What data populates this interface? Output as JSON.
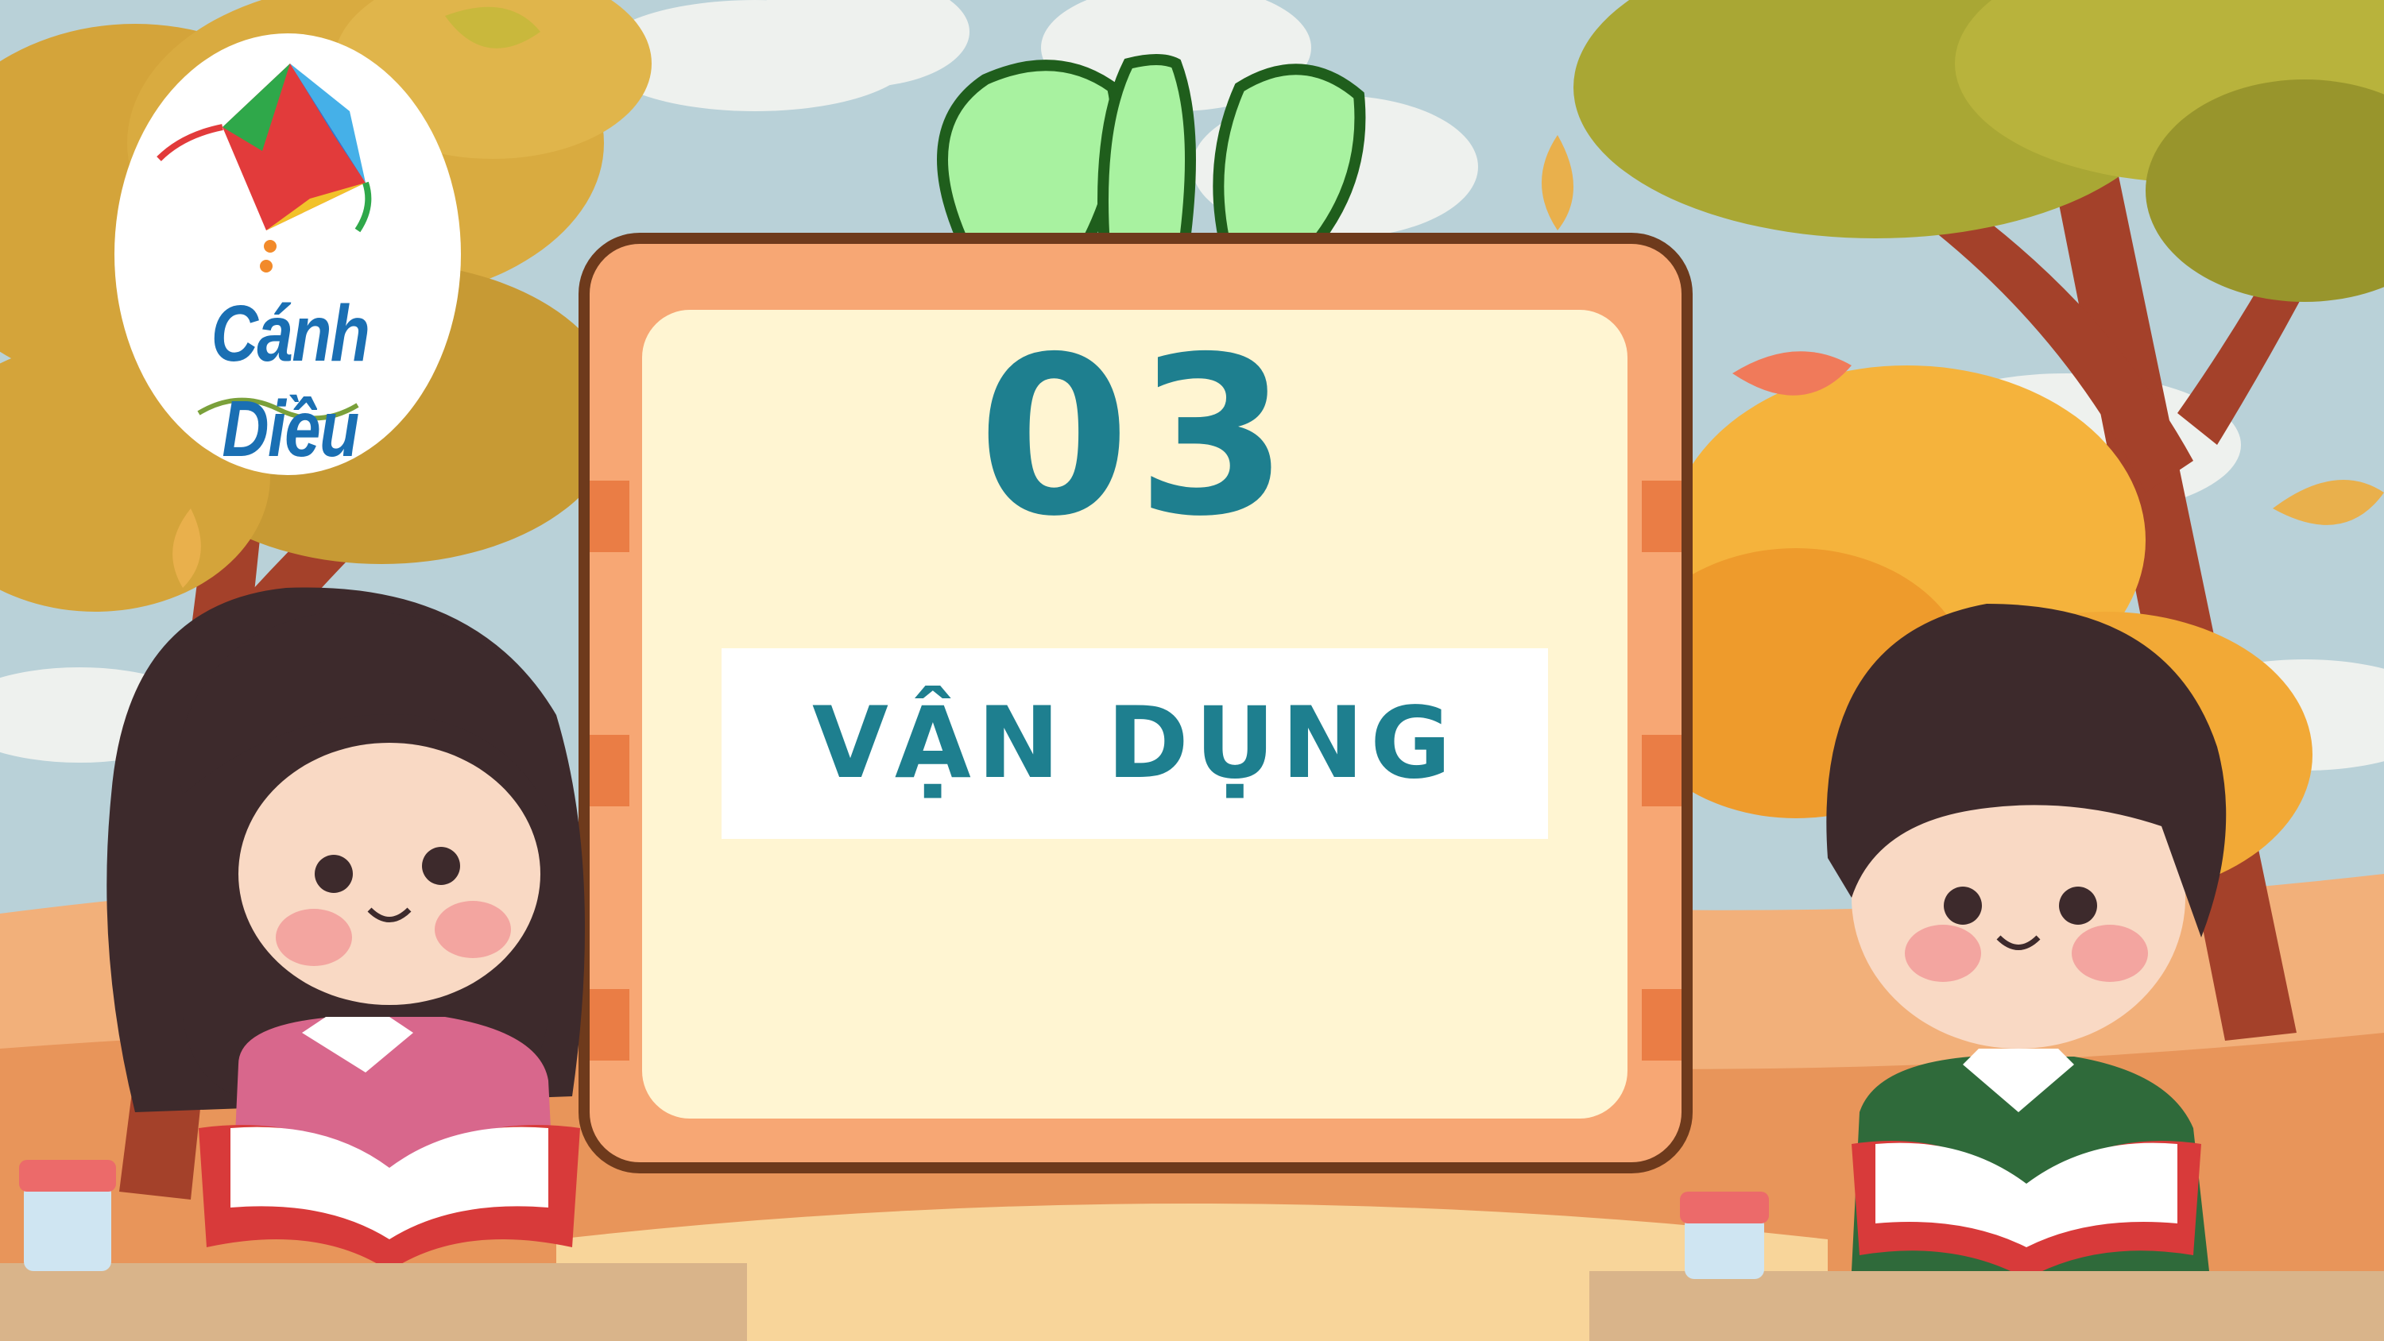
{
  "logo": {
    "text": "Cánh Diều",
    "icon": "kite-icon"
  },
  "card": {
    "number": "03",
    "title": "VẬN DỤNG"
  },
  "colors": {
    "sky": "#b9d1d8",
    "frame": "#f7a774",
    "frame_border": "#6e3a1c",
    "panel": "#fff5d2",
    "accent_text": "#1e7f8f",
    "leaf_green": "#a8f2a0"
  }
}
